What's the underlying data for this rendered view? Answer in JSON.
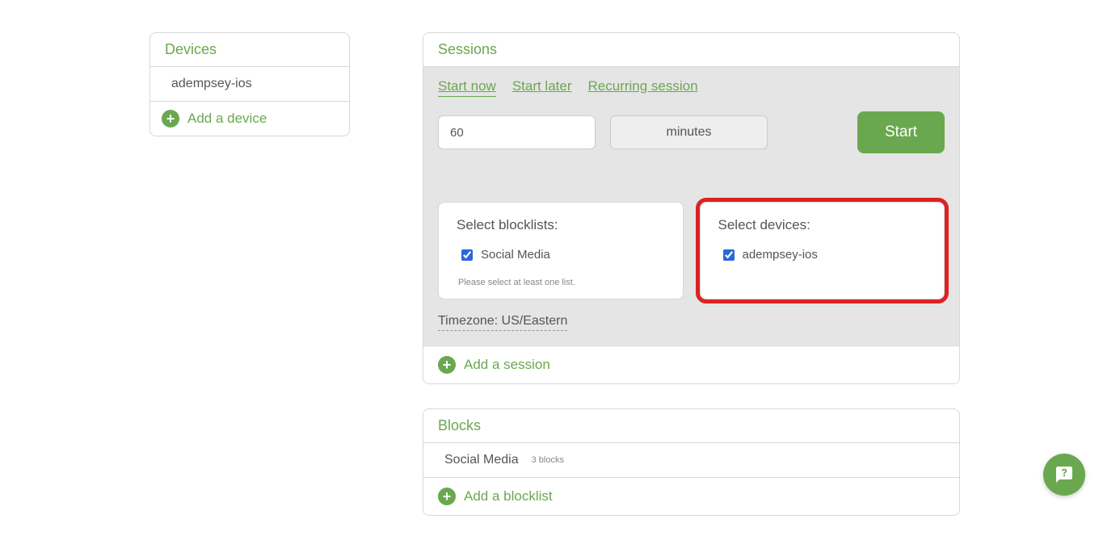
{
  "devices": {
    "header": "Devices",
    "items": [
      "adempsey-ios"
    ],
    "add_label": "Add a device"
  },
  "sessions": {
    "header": "Sessions",
    "tabs": {
      "start_now": "Start now",
      "start_later": "Start later",
      "recurring": "Recurring session"
    },
    "duration_value": "60",
    "unit_label": "minutes",
    "start_label": "Start",
    "blocklists": {
      "title": "Select blocklists:",
      "items": [
        {
          "label": "Social Media",
          "checked": true
        }
      ],
      "hint": "Please select at least one list."
    },
    "select_devices": {
      "title": "Select devices:",
      "items": [
        {
          "label": "adempsey-ios",
          "checked": true
        }
      ]
    },
    "timezone_label": "Timezone: US/Eastern",
    "add_label": "Add a session"
  },
  "blocks": {
    "header": "Blocks",
    "items": [
      {
        "name": "Social Media",
        "count_label": "3 blocks"
      }
    ],
    "add_label": "Add a blocklist"
  }
}
